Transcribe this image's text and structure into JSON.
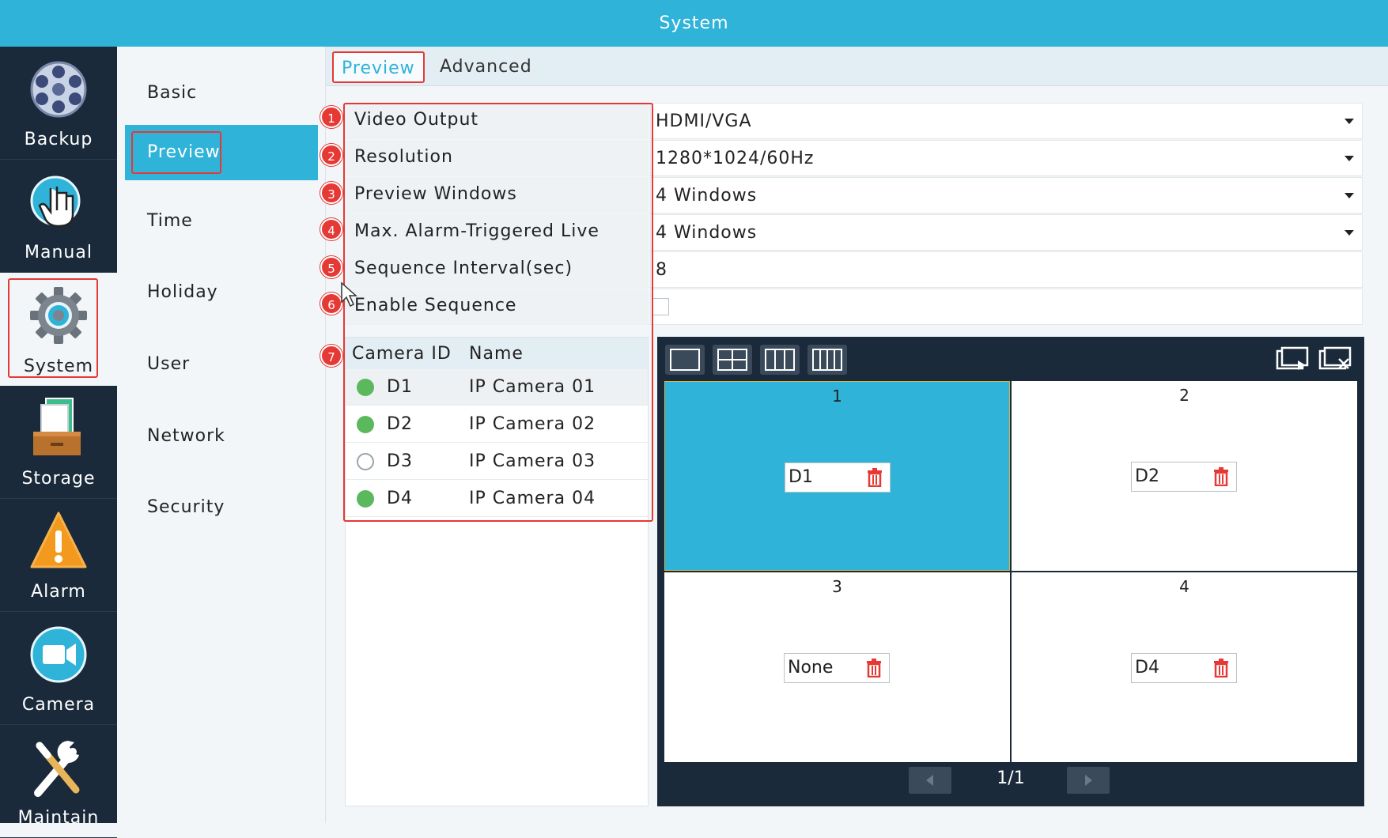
{
  "window": {
    "title": "System"
  },
  "nav": {
    "items": [
      {
        "label": "Backup",
        "icon": "film-reel-icon"
      },
      {
        "label": "Manual",
        "icon": "hand-pointer-icon"
      },
      {
        "label": "System",
        "icon": "gear-icon"
      },
      {
        "label": "Storage",
        "icon": "storage-icon"
      },
      {
        "label": "Alarm",
        "icon": "warning-icon"
      },
      {
        "label": "Camera",
        "icon": "camera-icon"
      },
      {
        "label": "Maintain",
        "icon": "tools-icon"
      }
    ],
    "active": "System"
  },
  "submenu": {
    "items": [
      "Basic",
      "Preview",
      "Time",
      "Holiday",
      "User",
      "Network",
      "Security"
    ],
    "active": "Preview"
  },
  "tabs": {
    "preview": "Preview",
    "advanced": "Advanced",
    "active": "Preview"
  },
  "settings": {
    "video_output": {
      "label": "Video Output",
      "value": "HDMI/VGA"
    },
    "resolution": {
      "label": "Resolution",
      "value": "1280*1024/60Hz"
    },
    "preview_windows": {
      "label": "Preview Windows",
      "value": "4 Windows"
    },
    "max_alarm": {
      "label": "Max. Alarm-Triggered Live Vie...",
      "value": "4 Windows"
    },
    "sequence_interval": {
      "label": "Sequence Interval(sec)",
      "value": "8"
    },
    "enable_sequence": {
      "label": "Enable Sequence",
      "checked": false
    }
  },
  "badges": [
    "1",
    "2",
    "3",
    "4",
    "5",
    "6",
    "7"
  ],
  "camera_list": {
    "headers": {
      "id": "Camera ID",
      "name": "Name"
    },
    "rows": [
      {
        "id": "D1",
        "name": "IP Camera 01",
        "online": true
      },
      {
        "id": "D2",
        "name": "IP Camera 02",
        "online": true
      },
      {
        "id": "D3",
        "name": "IP Camera 03",
        "online": false
      },
      {
        "id": "D4",
        "name": "IP Camera 04",
        "online": true
      }
    ]
  },
  "preview": {
    "cells": [
      {
        "number": "1",
        "camera": "D1"
      },
      {
        "number": "2",
        "camera": "D2"
      },
      {
        "number": "3",
        "camera": "None"
      },
      {
        "number": "4",
        "camera": "D4"
      }
    ],
    "page": "1/1"
  },
  "colors": {
    "accent": "#2fb3d8",
    "highlight": "#e53935",
    "nav_bg": "#1b2a3b",
    "online": "#5cb85c"
  }
}
